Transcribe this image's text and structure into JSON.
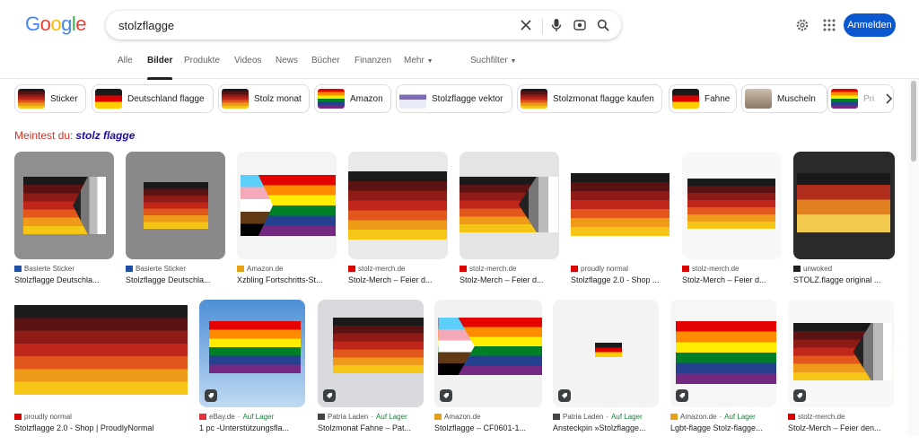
{
  "header": {
    "logo": "Google",
    "search_value": "stolzflagge",
    "signin_label": "Anmelden",
    "icons": [
      "clear-icon",
      "mic-icon",
      "lens-icon",
      "search-icon",
      "settings-icon",
      "apps-icon"
    ]
  },
  "tabs": [
    {
      "label": "Alle",
      "active": false
    },
    {
      "label": "Bilder",
      "active": true
    },
    {
      "label": "Produkte",
      "active": false
    },
    {
      "label": "Videos",
      "active": false
    },
    {
      "label": "News",
      "active": false
    },
    {
      "label": "Bücher",
      "active": false
    },
    {
      "label": "Finanzen",
      "active": false
    },
    {
      "label": "Mehr",
      "active": false
    },
    {
      "label": "Suchfilter",
      "active": false
    }
  ],
  "chips": [
    "Sticker",
    "Deutschland flagge",
    "Stolz monat",
    "Amazon",
    "Stolzflagge vektor",
    "Stolzmonat flagge kaufen",
    "Fahne",
    "Muscheln",
    "Pri"
  ],
  "suggestion": {
    "prefix": "Meintest du:",
    "query": "stolz flagge"
  },
  "row1": [
    {
      "source": "Basierte Sticker",
      "title": "Stolzflagge Deutschla..."
    },
    {
      "source": "Basierte Sticker",
      "title": "Stolzflagge Deutschla..."
    },
    {
      "source": "Amazon.de",
      "title": "Xzbling Fortschritts-St..."
    },
    {
      "source": "stolz-merch.de",
      "title": "Stolz-Merch – Feier d..."
    },
    {
      "source": "stolz-merch.de",
      "title": "Stolz-Merch – Feier d..."
    },
    {
      "source": "proudly normal",
      "title": "Stolzflagge 2.0 - Shop ..."
    },
    {
      "source": "stolz-merch.de",
      "title": "Stolz-Merch – Feier d..."
    },
    {
      "source": "unwoked",
      "title": "STOLZ.flagge original ..."
    }
  ],
  "row2": [
    {
      "source": "proudly normal",
      "stock": "",
      "title": "Stolzflagge 2.0 - Shop | ProudlyNormal"
    },
    {
      "source": "eBay.de",
      "stock": "Auf Lager",
      "title": "1 pc -Unterstützungsfla..."
    },
    {
      "source": "Patria Laden",
      "stock": "Auf Lager",
      "title": "Stolzmonat Fahne – Pat..."
    },
    {
      "source": "Amazon.de",
      "stock": "",
      "title": "Stolzflagge – CF0601-1..."
    },
    {
      "source": "Patria Laden",
      "stock": "Auf Lager",
      "title": "Ansteckpin »Stolzflagge..."
    },
    {
      "source": "Amazon.de",
      "stock": "Auf Lager",
      "title": "Lgbt-flagge Stolz-flagge..."
    },
    {
      "source": "stolz-merch.de",
      "stock": "",
      "title": "Stolz-Merch – Feier den..."
    }
  ],
  "colors": {
    "accent": "#0b57d0",
    "suggest_red": "#d93025",
    "link_blue": "#1a0dab",
    "stock_green": "#188038",
    "stolz_stripes": [
      "#1a1a1a",
      "#5a1212",
      "#8e1b16",
      "#c0261a",
      "#e2571c",
      "#f09a1a",
      "#f5c518"
    ],
    "rainbow": [
      "#e40303",
      "#ff8c00",
      "#ffed00",
      "#008026",
      "#24408e",
      "#732982"
    ]
  }
}
